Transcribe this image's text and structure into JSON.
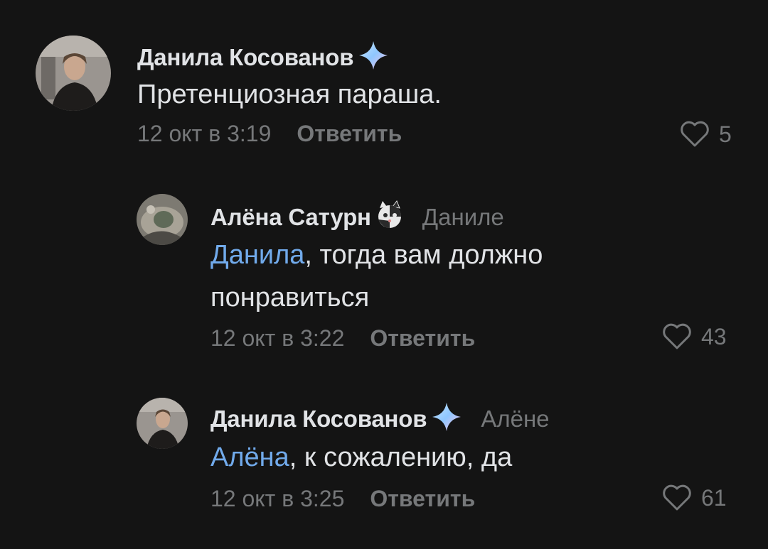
{
  "comments": [
    {
      "author": "Данила Косованов",
      "badge": "sparkle-icon",
      "reply_to": "",
      "mention": "",
      "text": "Претенциозная параша.",
      "date": "12 окт в 3:19",
      "reply_label": "Ответить",
      "likes": "5"
    },
    {
      "author": "Алёна Сатурн",
      "badge": "cat-emoji-icon",
      "reply_to": "Даниле",
      "mention": "Данила",
      "text": ", тогда вам должно понравиться",
      "date": "12 окт в 3:22",
      "reply_label": "Ответить",
      "likes": "43"
    },
    {
      "author": "Данила Косованов",
      "badge": "sparkle-icon",
      "reply_to": "Алёне",
      "mention": "Алёна",
      "text": ", к сожалению, да",
      "date": "12 окт в 3:25",
      "reply_label": "Ответить",
      "likes": "61"
    }
  ],
  "colors": {
    "background": "#141414",
    "text": "#e1e3e6",
    "secondary": "#76787a",
    "mention": "#71aaeb"
  }
}
